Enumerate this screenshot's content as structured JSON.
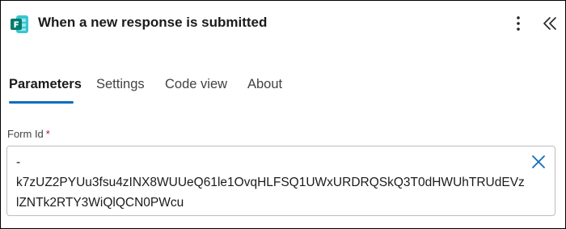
{
  "header": {
    "title": "When a new response is submitted",
    "app_icon": "microsoft-forms-icon",
    "more_icon": "more-vertical-icon",
    "collapse_icon": "double-chevron-left-icon"
  },
  "tabs": [
    {
      "label": "Parameters",
      "active": true
    },
    {
      "label": "Settings",
      "active": false
    },
    {
      "label": "Code view",
      "active": false
    },
    {
      "label": "About",
      "active": false
    }
  ],
  "form": {
    "form_id_label": "Form Id",
    "required_marker": "*",
    "form_id_value": "-\nk7zUZ2PYUu3fsu4zINX8WUUeQ61le1OvqHLFSQ1UWxURDRQSkQ3T0dHWUhTRUdEVzlZNTk2RTY3WiQlQCN0PWcu",
    "clear_icon": "close-icon"
  },
  "colors": {
    "accent": "#0f6cbd",
    "forms_green": "#037c6e",
    "required": "#c50f1f",
    "clear_icon": "#0f6cbd"
  }
}
